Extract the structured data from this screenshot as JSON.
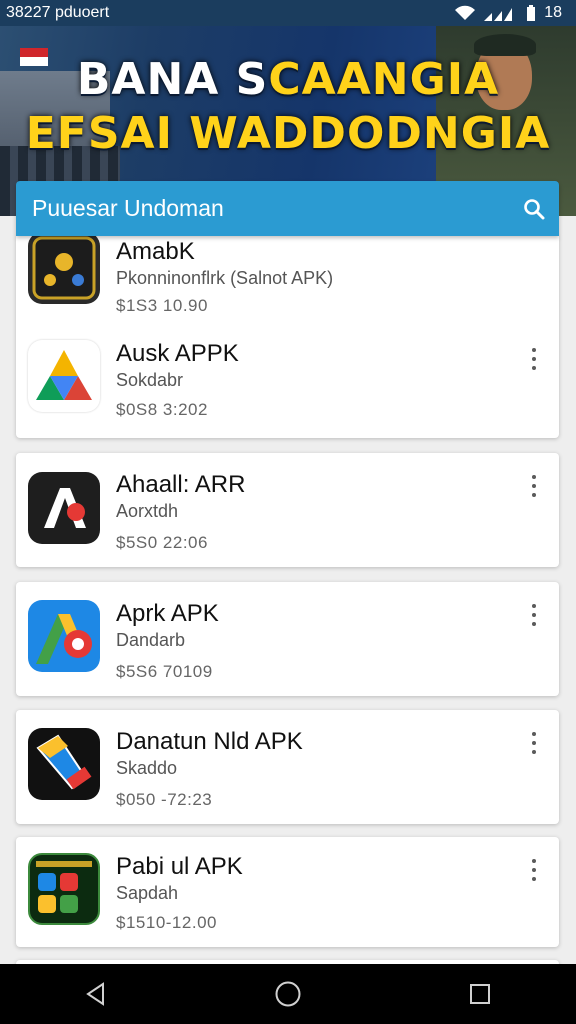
{
  "status_bar": {
    "time": "38227 pduoert",
    "battery": "18"
  },
  "banner": {
    "line1_a": "BANA S",
    "line1_b": "CAANGIA",
    "line2": "EFSAI WADDODNGIA"
  },
  "search": {
    "placeholder": "Puuesar Undoman"
  },
  "apps": [
    {
      "name": "AmabK",
      "sub": "Pkonninonflrk (Salnot APK)",
      "price": "$1S3  10.90"
    },
    {
      "name": "Ausk APPK",
      "sub": "Sokdabr",
      "price": "$0S8  3:202"
    },
    {
      "name": "Ahaall: ARR",
      "sub": "Aorxtdh",
      "price": "$5S0  22:06"
    },
    {
      "name": "Aprk APK",
      "sub": "Dandarb",
      "price": "$5S6  70109"
    },
    {
      "name": "Danatun Nld APK",
      "sub": "Skaddo",
      "price": "$050 -72:23"
    },
    {
      "name": "Pabi ul APK",
      "sub": "Sapdah",
      "price": "$1510-12.00"
    }
  ],
  "colors": {
    "accent": "#2b9bd2",
    "status_bar": "#1b3d5e",
    "nav_bar": "#000000"
  }
}
